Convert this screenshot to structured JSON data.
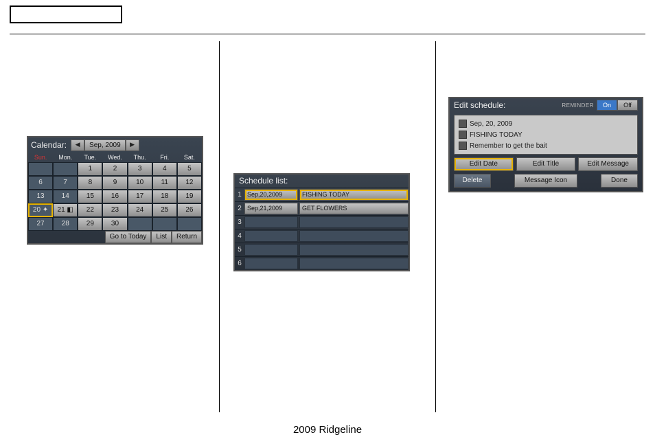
{
  "footer": "2009  Ridgeline",
  "calendar": {
    "title": "Calendar:",
    "nav_prev": "◀",
    "nav_next": "▶",
    "month_label": "Sep, 2009",
    "day_headers": [
      "Sun.",
      "Mon.",
      "Tue.",
      "Wed.",
      "Thu.",
      "Fri.",
      "Sat."
    ],
    "grid": [
      [
        {
          "v": ""
        },
        {
          "v": ""
        },
        {
          "v": "1",
          "s": true
        },
        {
          "v": "2",
          "s": true
        },
        {
          "v": "3",
          "s": true
        },
        {
          "v": "4",
          "s": true
        },
        {
          "v": "5",
          "s": true
        }
      ],
      [
        {
          "v": "6"
        },
        {
          "v": "7"
        },
        {
          "v": "8",
          "s": true
        },
        {
          "v": "9",
          "s": true
        },
        {
          "v": "10",
          "s": true
        },
        {
          "v": "11",
          "s": true
        },
        {
          "v": "12",
          "s": true
        }
      ],
      [
        {
          "v": "13"
        },
        {
          "v": "14"
        },
        {
          "v": "15",
          "s": true
        },
        {
          "v": "16",
          "s": true
        },
        {
          "v": "17",
          "s": true
        },
        {
          "v": "18",
          "s": true
        },
        {
          "v": "19",
          "s": true
        }
      ],
      [
        {
          "v": "20 ✦",
          "hl": true
        },
        {
          "v": "21 ◧",
          "s": true
        },
        {
          "v": "22",
          "s": true
        },
        {
          "v": "23",
          "s": true
        },
        {
          "v": "24",
          "s": true
        },
        {
          "v": "25",
          "s": true
        },
        {
          "v": "26",
          "s": true
        }
      ],
      [
        {
          "v": "27"
        },
        {
          "v": "28"
        },
        {
          "v": "29",
          "s": true
        },
        {
          "v": "30",
          "s": true
        },
        {
          "v": ""
        },
        {
          "v": ""
        },
        {
          "v": ""
        }
      ]
    ],
    "footer_buttons": {
      "today": "Go to Today",
      "list": "List",
      "return": "Return"
    }
  },
  "schedule_list": {
    "title": "Schedule list:",
    "rows": [
      {
        "n": "1",
        "date": "Sep,20,2009",
        "title": "FISHING TODAY",
        "sel": true
      },
      {
        "n": "2",
        "date": "Sep,21,2009",
        "title": "GET FLOWERS"
      },
      {
        "n": "3"
      },
      {
        "n": "4"
      },
      {
        "n": "5"
      },
      {
        "n": "6"
      }
    ]
  },
  "edit_schedule": {
    "title": "Edit schedule:",
    "reminder_label": "REMINDER",
    "on": "On",
    "off": "Off",
    "date": "Sep, 20, 2009",
    "title_text": "FISHING TODAY",
    "message": "Remember to get the bait",
    "buttons": {
      "edit_date": "Edit Date",
      "edit_title": "Edit Title",
      "edit_message": "Edit Message",
      "delete": "Delete",
      "message_icon": "Message Icon",
      "done": "Done"
    }
  }
}
